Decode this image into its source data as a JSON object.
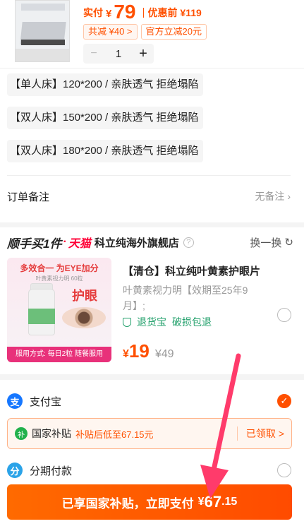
{
  "order_item": {
    "price_label": "实付",
    "currency": "¥",
    "price": "79",
    "pre_discount": "优惠前 ¥119",
    "tags": [
      "共减 ¥40 >",
      "官方立减20元"
    ],
    "quantity": "1",
    "minus": "−",
    "plus": "+"
  },
  "specs": [
    "【单人床】120*200 / 亲肤透气 拒绝塌陷",
    "【双人床】150*200 / 亲肤透气 拒绝塌陷",
    "【双人床】180*200 / 亲肤透气 拒绝塌陷"
  ],
  "remark": {
    "label": "订单备注",
    "value": "无备注 ›"
  },
  "recommend": {
    "logo_text": "顺手买1件",
    "tmall": "天猫",
    "shop": "科立纯海外旗舰店",
    "help": "?",
    "swap": "换一换",
    "swap_icon": "↻",
    "image_headline": "多效合一 为EYE加分",
    "image_sub": "叶黄素视力明 60粒",
    "image_eye_text": "护眼",
    "image_footer": "服用方式: 每日2粒 随餐服用",
    "title": "【清仓】科立纯叶黄素护眼片",
    "desc": "叶黄素视力明【效期至25年9月】;",
    "badges": [
      "退货宝",
      "破损包退"
    ],
    "yen": "¥",
    "price": "19",
    "old_price": "¥49"
  },
  "payment": {
    "alipay_icon": "支",
    "alipay": "支付宝",
    "check": "✓",
    "subsidy_icon": "补",
    "subsidy_name": "国家补贴",
    "subsidy_desc": "补贴后低至67.15元",
    "subsidy_btn": "已领取 >",
    "installment_icon": "分",
    "installment": "分期付款",
    "pay_text": "已享国家补贴，立即支付",
    "pay_yen": "¥",
    "pay_int": "67",
    "pay_dec": ".15"
  },
  "colors": {
    "accent": "#ff5000",
    "tmall_red": "#ff0036",
    "green": "#22a06b",
    "annotation": "#ff3b6b"
  }
}
